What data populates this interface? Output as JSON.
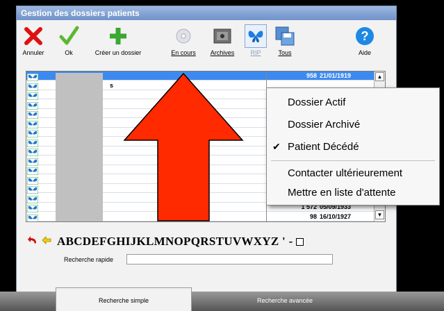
{
  "window": {
    "title": "Gestion des dossiers patients"
  },
  "toolbar": {
    "annuler": "Annuler",
    "ok": "Ok",
    "creer": "Créer un dossier",
    "en_cours": "En cours",
    "archives": "Archives",
    "rip": "RIP",
    "tous": "Tous",
    "aide": "Aide"
  },
  "list": {
    "rows": [
      {
        "number": "958",
        "date": "21/01/1919"
      },
      {
        "number": "1 572",
        "date": "05/09/1933"
      },
      {
        "number": "98",
        "date": "16/10/1927"
      }
    ],
    "name_fragment": "s"
  },
  "context_menu": {
    "items": [
      {
        "label": "Dossier Actif",
        "checked": false
      },
      {
        "label": "Dossier Archivé",
        "checked": false
      },
      {
        "label": "Patient Décédé",
        "checked": true
      },
      {
        "label": "Contacter ultérieurement",
        "checked": false
      },
      {
        "label": "Mettre en liste d'attente",
        "checked": false
      }
    ]
  },
  "alphabet": {
    "letters": "ABCDEFGHIJKLMNOPQRSTUVWXYZ ' -"
  },
  "search": {
    "label": "Recherche rapide",
    "value": ""
  },
  "tabs": {
    "simple": "Recherche simple",
    "advanced": "Recherche avancée"
  },
  "colors": {
    "selection": "#3c8af0",
    "title": "#6f92c9",
    "arrow": "#ff2a00"
  }
}
